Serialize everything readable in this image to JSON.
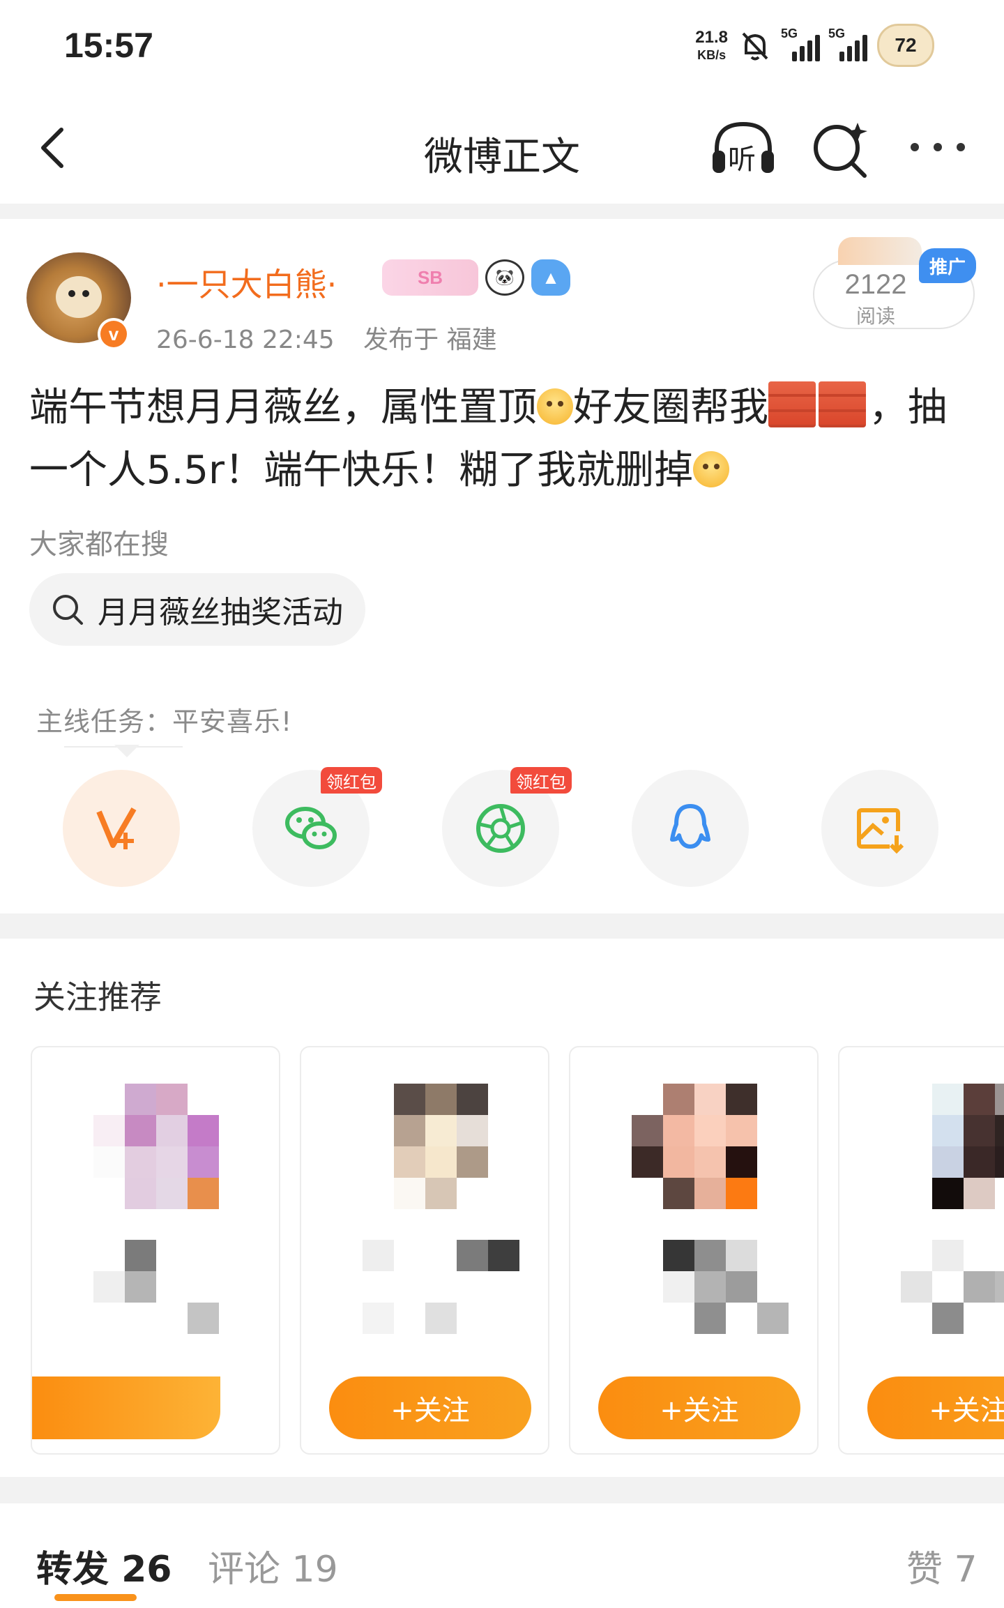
{
  "status_bar": {
    "time": "15:57",
    "net_speed_value": "21.8",
    "net_speed_unit": "KB/s",
    "signal1_label": "5G",
    "signal2_label": "5G",
    "battery": "72"
  },
  "nav": {
    "title": "微博正文",
    "listen_label": "听"
  },
  "post": {
    "author": "·一只大白熊·",
    "vip_badge": "SB",
    "verified_mark": "v",
    "time": "26-6-18 22:45",
    "location": "发布于 福建",
    "read_count": "2122",
    "read_label": "阅读",
    "promo_label": "推广",
    "text_part1": "端午节想月月薇丝，属性置顶",
    "text_part2": "好友圈帮我",
    "text_part3": "，抽一个人5.5r！端午快乐！糊了我就删掉",
    "search_hint": "大家都在搜",
    "search_chip": "月月薇丝抽奖活动",
    "mission": "主线任务：平安喜乐!"
  },
  "share": {
    "items": [
      {
        "name": "weibo-share",
        "icon": "v-plus-icon"
      },
      {
        "name": "wechat",
        "icon": "wechat-icon",
        "badge": "领红包"
      },
      {
        "name": "moments",
        "icon": "moments-icon",
        "badge": "领红包"
      },
      {
        "name": "qq",
        "icon": "qq-icon"
      },
      {
        "name": "save-image",
        "icon": "save-image-icon"
      }
    ]
  },
  "recommend": {
    "title": "关注推荐",
    "follow_label": "+关注"
  },
  "tabs": {
    "repost": "转发 26",
    "comment": "评论 19",
    "like": "赞 7"
  },
  "colors": {
    "accent": "#f9921b",
    "username": "#f26c1d",
    "redpack": "#f24b3c",
    "promo": "#3f8ff0"
  }
}
